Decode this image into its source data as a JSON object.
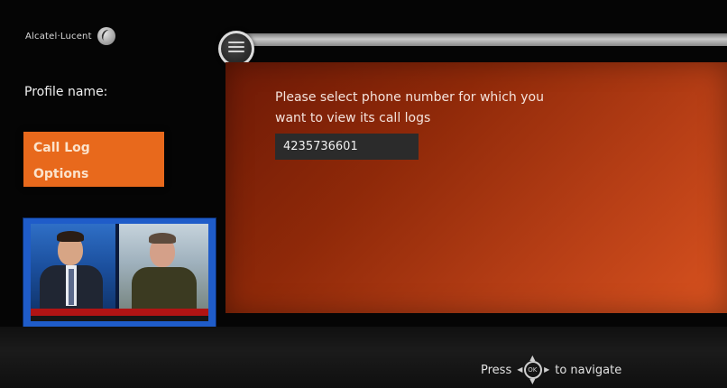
{
  "brand": {
    "name": "Alcatel·Lucent",
    "logo_icon": "alcatel-lucent-logo"
  },
  "profile": {
    "label": "Profile name:"
  },
  "menu": {
    "items": [
      {
        "label": "Call Log"
      },
      {
        "label": "Options"
      }
    ],
    "color": "#e8691c"
  },
  "main": {
    "prompt": "Please select phone number for which you want to view its call logs",
    "phone_number": "4235736601",
    "panel_color": "#b83f16"
  },
  "footer": {
    "press": "Press",
    "navigate": "to navigate",
    "nav_icon": "dpad-ok-icon",
    "ok_label": "OK"
  }
}
